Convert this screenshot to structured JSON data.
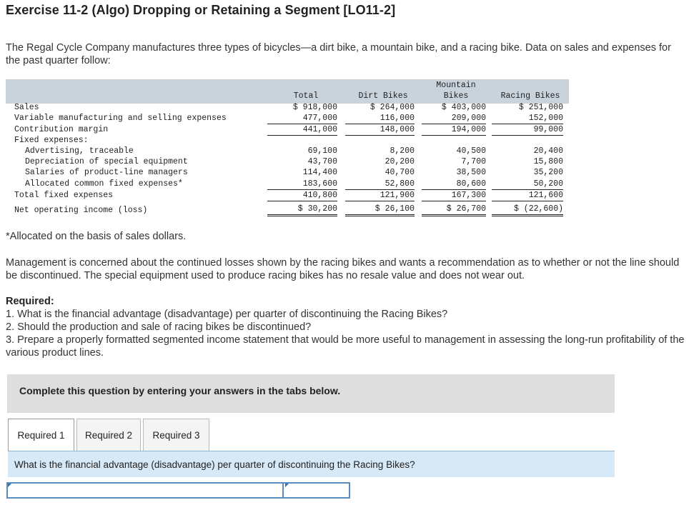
{
  "title": "Exercise 11-2 (Algo) Dropping or Retaining a Segment [LO11-2]",
  "intro": "The Regal Cycle Company manufactures three types of bicycles—a dirt bike, a mountain bike, and a racing bike. Data on sales and expenses for the past quarter follow:",
  "table": {
    "headers": {
      "total": "Total",
      "dirt": "Dirt Bikes",
      "mountain_1": "Mountain",
      "mountain_2": "Bikes",
      "racing": "Racing Bikes"
    },
    "rows": [
      {
        "label": "Sales",
        "total": "$ 918,000",
        "dirt": "$ 264,000",
        "mountain": "$ 403,000",
        "racing": "$ 251,000"
      },
      {
        "label": "Variable manufacturing and selling expenses",
        "total": "477,000",
        "dirt": "116,000",
        "mountain": "209,000",
        "racing": "152,000"
      },
      {
        "label": "Contribution margin",
        "total": "441,000",
        "dirt": "148,000",
        "mountain": "194,000",
        "racing": "99,000"
      },
      {
        "label": "Fixed expenses:",
        "total": "",
        "dirt": "",
        "mountain": "",
        "racing": ""
      },
      {
        "label": "Advertising, traceable",
        "total": "69,100",
        "dirt": "8,200",
        "mountain": "40,500",
        "racing": "20,400"
      },
      {
        "label": "Depreciation of special equipment",
        "total": "43,700",
        "dirt": "20,200",
        "mountain": "7,700",
        "racing": "15,800"
      },
      {
        "label": "Salaries of product-line managers",
        "total": "114,400",
        "dirt": "40,700",
        "mountain": "38,500",
        "racing": "35,200"
      },
      {
        "label": "Allocated common fixed expenses*",
        "total": "183,600",
        "dirt": "52,800",
        "mountain": "80,600",
        "racing": "50,200"
      },
      {
        "label": "Total fixed expenses",
        "total": "410,800",
        "dirt": "121,900",
        "mountain": "167,300",
        "racing": "121,600"
      },
      {
        "label": "Net operating income (loss)",
        "total": "$ 30,200",
        "dirt": "$ 26,100",
        "mountain": "$ 26,700",
        "racing": "$ (22,600)"
      }
    ]
  },
  "footnote": "*Allocated on the basis of sales dollars.",
  "management": "Management is concerned about the continued losses shown by the racing bikes and wants a recommendation as to whether or not the line should be discontinued. The special equipment used to produce racing bikes has no resale value and does not wear out.",
  "required": {
    "heading": "Required:",
    "items": [
      "1. What is the financial advantage (disadvantage) per quarter of discontinuing the Racing Bikes?",
      "2. Should the production and sale of racing bikes be discontinued?",
      "3. Prepare a properly formatted segmented income statement that would be more useful to management in assessing the long-run profitability of the various product lines."
    ]
  },
  "complete_prompt": "Complete this question by entering your answers in the tabs below.",
  "tabs": [
    {
      "label": "Required 1"
    },
    {
      "label": "Required 2"
    },
    {
      "label": "Required 3"
    }
  ],
  "question": "What is the financial advantage (disadvantage) per quarter of discontinuing the Racing Bikes?",
  "answer": {
    "label_value": "",
    "amount_value": ""
  },
  "colors": {
    "header_band": "#c9d3dc",
    "question_band": "#d7e8f6",
    "input_border": "#5a8dc0",
    "instruction_band": "#dedede"
  }
}
